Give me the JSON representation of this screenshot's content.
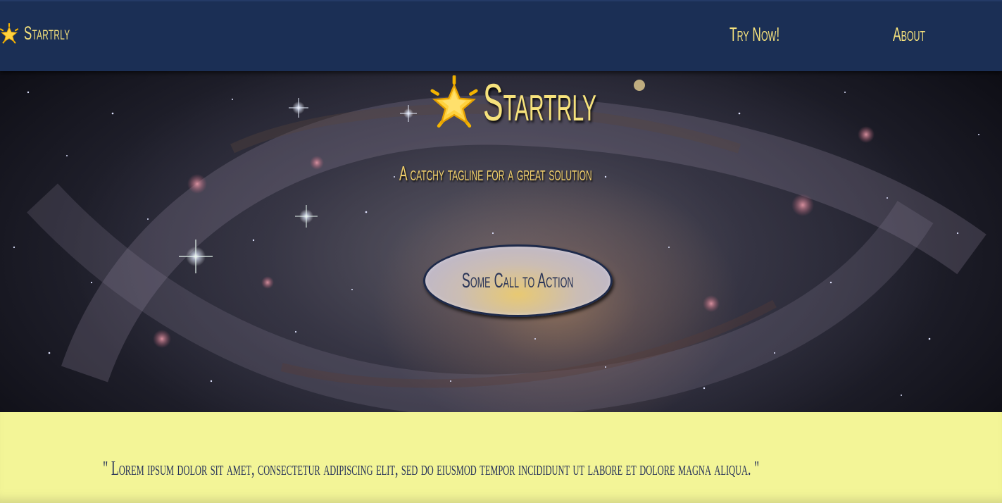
{
  "nav": {
    "brand_icon": "glowing-star-icon",
    "brand_label": "Startrly",
    "links": [
      {
        "label": "Try Now!"
      },
      {
        "label": "About"
      }
    ]
  },
  "hero": {
    "title_icon": "glowing-star-icon",
    "title": "Startrly",
    "tagline": "A catchy tagline for a great solution",
    "cta_label": "Some Call to Action",
    "background": "spiral-galaxy-image"
  },
  "quote": {
    "text": "\" Lorem ipsum dolor sit amet, consectetur adipiscing elit, sed do eiusmod tempor incididunt ut labore et dolore magna aliqua. \""
  },
  "colors": {
    "nav_background": "#1b2f55",
    "accent_gold": "#f6e27c",
    "quote_background": "#f3f597",
    "quote_text": "#26325a"
  }
}
